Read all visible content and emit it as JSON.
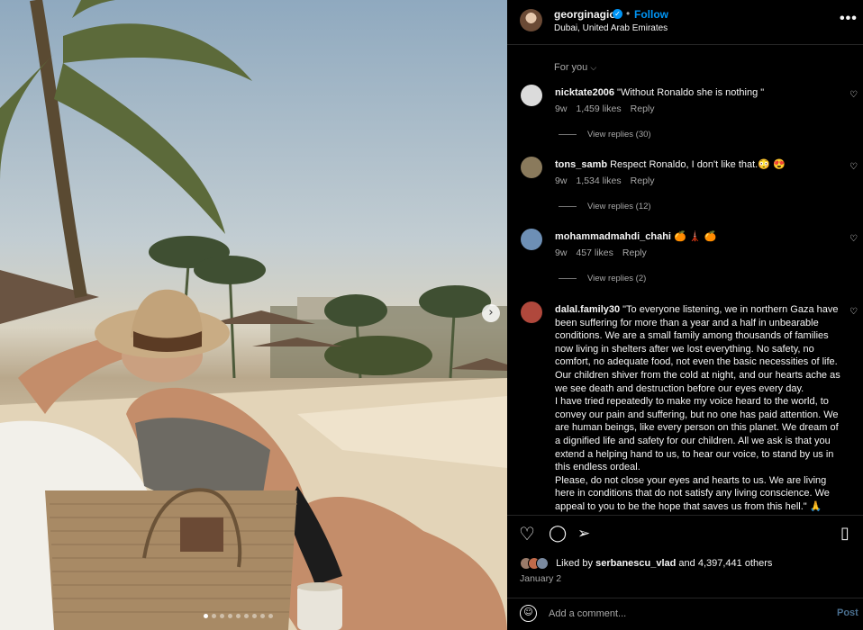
{
  "post": {
    "username": "georginagio",
    "follow_label": "Follow",
    "separator": "•",
    "location": "Dubai, United Arab Emirates",
    "more_icon": "more-options-icon",
    "more_glyph": "•••",
    "verified_glyph": "✓"
  },
  "carousel": {
    "slide_count": 9,
    "active_index": 0,
    "next_glyph": "›"
  },
  "filter": {
    "label": "For you",
    "chevron": "⌵"
  },
  "comments": [
    {
      "user": "nicktate2006",
      "text": "\"Without Ronaldo she is nothing \"",
      "age": "9w",
      "likes": "1,459 likes",
      "reply": "Reply",
      "view_replies": "View replies (30)",
      "avatar_color": "#dbdbdb"
    },
    {
      "user": "tons_samb",
      "text": "Respect Ronaldo, I don't like that.😳 😍",
      "age": "9w",
      "likes": "1,534 likes",
      "reply": "Reply",
      "view_replies": "View replies (12)",
      "avatar_color": "#8a7a5c"
    },
    {
      "user": "mohammadmahdi_chahi",
      "text": "🍊 🗼 🍊",
      "age": "9w",
      "likes": "457 likes",
      "reply": "Reply",
      "view_replies": "View replies (2)",
      "avatar_color": "#6d8fb5"
    },
    {
      "user": "dalal.family30",
      "text": "\"To everyone listening, we in northern Gaza have been suffering for more than a year and a half in unbearable conditions. We are a small family among thousands of families now living in shelters after we lost everything. No safety, no comfort, no adequate food, not even the basic necessities of life. Our children shiver from the cold at night, and our hearts ache as we see death and destruction before our eyes every day.\nI have tried repeatedly to make my voice heard to the world, to convey our pain and suffering, but no one has paid attention. We are human beings, like every person on this planet. We dream of a dignified life and safety for our children. All we ask is that you extend a helping hand to us, to hear our voice, to stand by us in this endless ordeal.\nPlease, do not close your eyes and hearts to us. We are living here in conditions that do not satisfy any living conscience. We appeal to you to be the hope that saves us from this hell.\" 🙏",
      "avatar_color": "#b0483c"
    }
  ],
  "heart_glyph": "♡",
  "actions": {
    "like_icon": "heart-icon",
    "like_glyph": "♡",
    "comment_icon": "comment-icon",
    "comment_glyph": "◯",
    "share_icon": "share-icon",
    "share_glyph": "➢",
    "save_icon": "bookmark-icon",
    "save_glyph": "▯"
  },
  "likes": {
    "prefix": "Liked by ",
    "user": "serbanescu_vlad",
    "suffix": " and 4,397,441 others",
    "avatar_colors": [
      "#9a7b6a",
      "#c06a4a",
      "#7a8aa0"
    ]
  },
  "date": "January 2",
  "add_comment": {
    "placeholder": "Add a comment...",
    "post_label": "Post",
    "emoji_glyph": "☺"
  },
  "colors": {
    "accent": "#0095f6",
    "background": "#000000",
    "muted": "#a8a8a8"
  }
}
